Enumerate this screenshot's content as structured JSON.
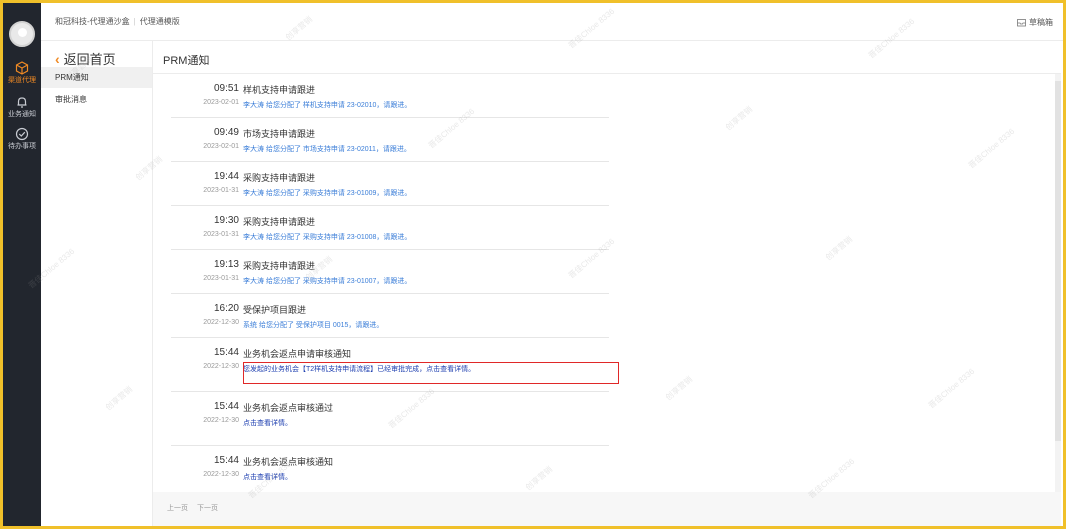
{
  "topbar": {
    "breadcrumb_company": "和冠科技-代理通沙盒",
    "breadcrumb_app": "代理通模版",
    "drafts_label": "草稿箱"
  },
  "rail": {
    "items": [
      {
        "label": "渠道代理",
        "icon": "cube-icon",
        "active": true
      },
      {
        "label": "业务通知",
        "icon": "bell-icon",
        "active": false
      },
      {
        "label": "待办事项",
        "icon": "check-circle-icon",
        "active": false
      }
    ]
  },
  "subnav": {
    "back_label": "返回首页",
    "items": [
      {
        "label": "PRM通知",
        "selected": true
      },
      {
        "label": "审批消息",
        "selected": false
      }
    ]
  },
  "main": {
    "title": "PRM通知",
    "notices": [
      {
        "time": "09:51",
        "date": "2023-02-01",
        "title": "样机支持申请跟进",
        "desc": "李大涛 给您分配了 样机支持申请 23-02010，请跟进。"
      },
      {
        "time": "09:49",
        "date": "2023-02-01",
        "title": "市场支持申请跟进",
        "desc": "李大涛 给您分配了 市场支持申请 23-02011，请跟进。"
      },
      {
        "time": "19:44",
        "date": "2023-01-31",
        "title": "采购支持申请跟进",
        "desc": "李大涛 给您分配了 采购支持申请 23-01009，请跟进。"
      },
      {
        "time": "19:30",
        "date": "2023-01-31",
        "title": "采购支持申请跟进",
        "desc": "李大涛 给您分配了 采购支持申请 23-01008，请跟进。"
      },
      {
        "time": "19:13",
        "date": "2023-01-31",
        "title": "采购支持申请跟进",
        "desc": "李大涛 给您分配了 采购支持申请 23-01007，请跟进。"
      },
      {
        "time": "16:20",
        "date": "2022-12-30",
        "title": "受保护项目跟进",
        "desc": "系统 给您分配了 受保护项目 0015，请跟进。"
      },
      {
        "time": "15:44",
        "date": "2022-12-30",
        "title": "业务机会返点申请审核通知",
        "desc": "您发起的业务机会【T2样机支持申请流程】已经审批完成，点击查看详情。"
      },
      {
        "time": "15:44",
        "date": "2022-12-30",
        "title": "业务机会返点审核通过",
        "desc": "点击查看详情。"
      },
      {
        "time": "15:44",
        "date": "2022-12-30",
        "title": "业务机会返点审核通知",
        "desc": "点击查看详情。"
      }
    ],
    "pager": {
      "prev": "上一页",
      "next": "下一页"
    }
  },
  "watermarks": [
    "创享营销",
    "晋佳Chloe 8336"
  ],
  "colors": {
    "accent": "#f08a24",
    "rail_bg": "#22262e",
    "link": "#3b7ed8",
    "frame": "#f0c02a",
    "highlight": "#e02828"
  }
}
